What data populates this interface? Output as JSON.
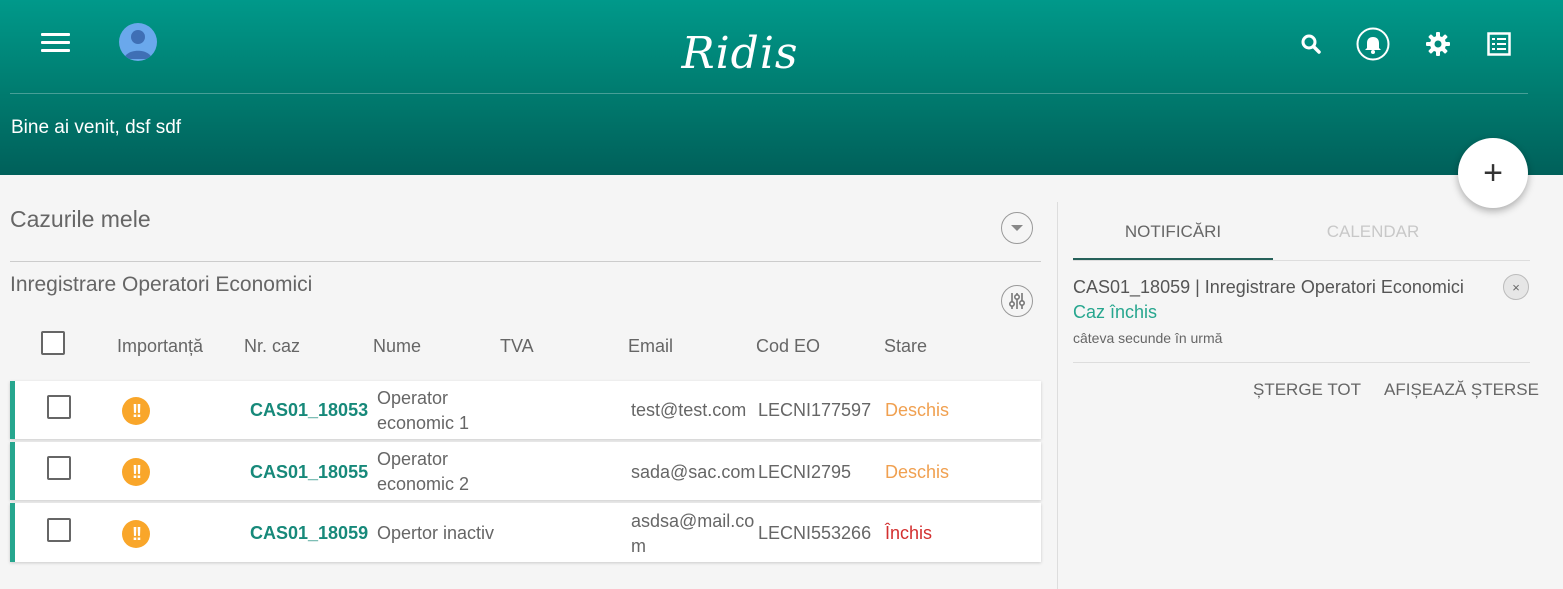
{
  "header": {
    "logo": "Ridis",
    "welcome": "Bine ai venit, dsf sdf"
  },
  "fab": {
    "label": "+"
  },
  "cases": {
    "section_title": "Cazurile mele",
    "group_title": "Inregistrare Operatori Economici",
    "columns": [
      "Importanță",
      "Nr. caz",
      "Nume",
      "TVA",
      "Email",
      "Cod EO",
      "Stare"
    ],
    "rows": [
      {
        "importance": "!!",
        "case_no": "CAS01_18053",
        "name": "Operator\neconomic 1",
        "tva": "",
        "email": "test@test.com",
        "cod_eo": "LECNI177597",
        "status": "Deschis",
        "status_color": "#f0a050"
      },
      {
        "importance": "!!",
        "case_no": "CAS01_18055",
        "name": "Operator\neconomic 2",
        "tva": "",
        "email": "sada@sac.com",
        "cod_eo": "LECNI2795",
        "status": "Deschis",
        "status_color": "#f0a050"
      },
      {
        "importance": "!!",
        "case_no": "CAS01_18059",
        "name": "Opertor inactiv",
        "tva": "",
        "email": "asdsa@mail.co\nm",
        "cod_eo": "LECNI553266",
        "status": "Închis",
        "status_color": "#d32f2f"
      }
    ]
  },
  "notifications": {
    "tabs": [
      {
        "label": "NOTIFICĂRI",
        "active": true
      },
      {
        "label": "CALENDAR",
        "active": false
      }
    ],
    "items": [
      {
        "title": "CAS01_18059 | Inregistrare Operatori Economici",
        "status": "Caz închis",
        "time": "câteva secunde în urmă",
        "close": "×"
      }
    ],
    "actions": {
      "delete_all": "ȘTERGE TOT",
      "show_deleted": "AFIȘEAZĂ ȘTERSE"
    }
  },
  "colors": {
    "header": "#00897b",
    "accent": "#26a68e",
    "importance": "#f9a62a",
    "status_open": "#f0a050",
    "status_closed": "#d32f2f"
  }
}
